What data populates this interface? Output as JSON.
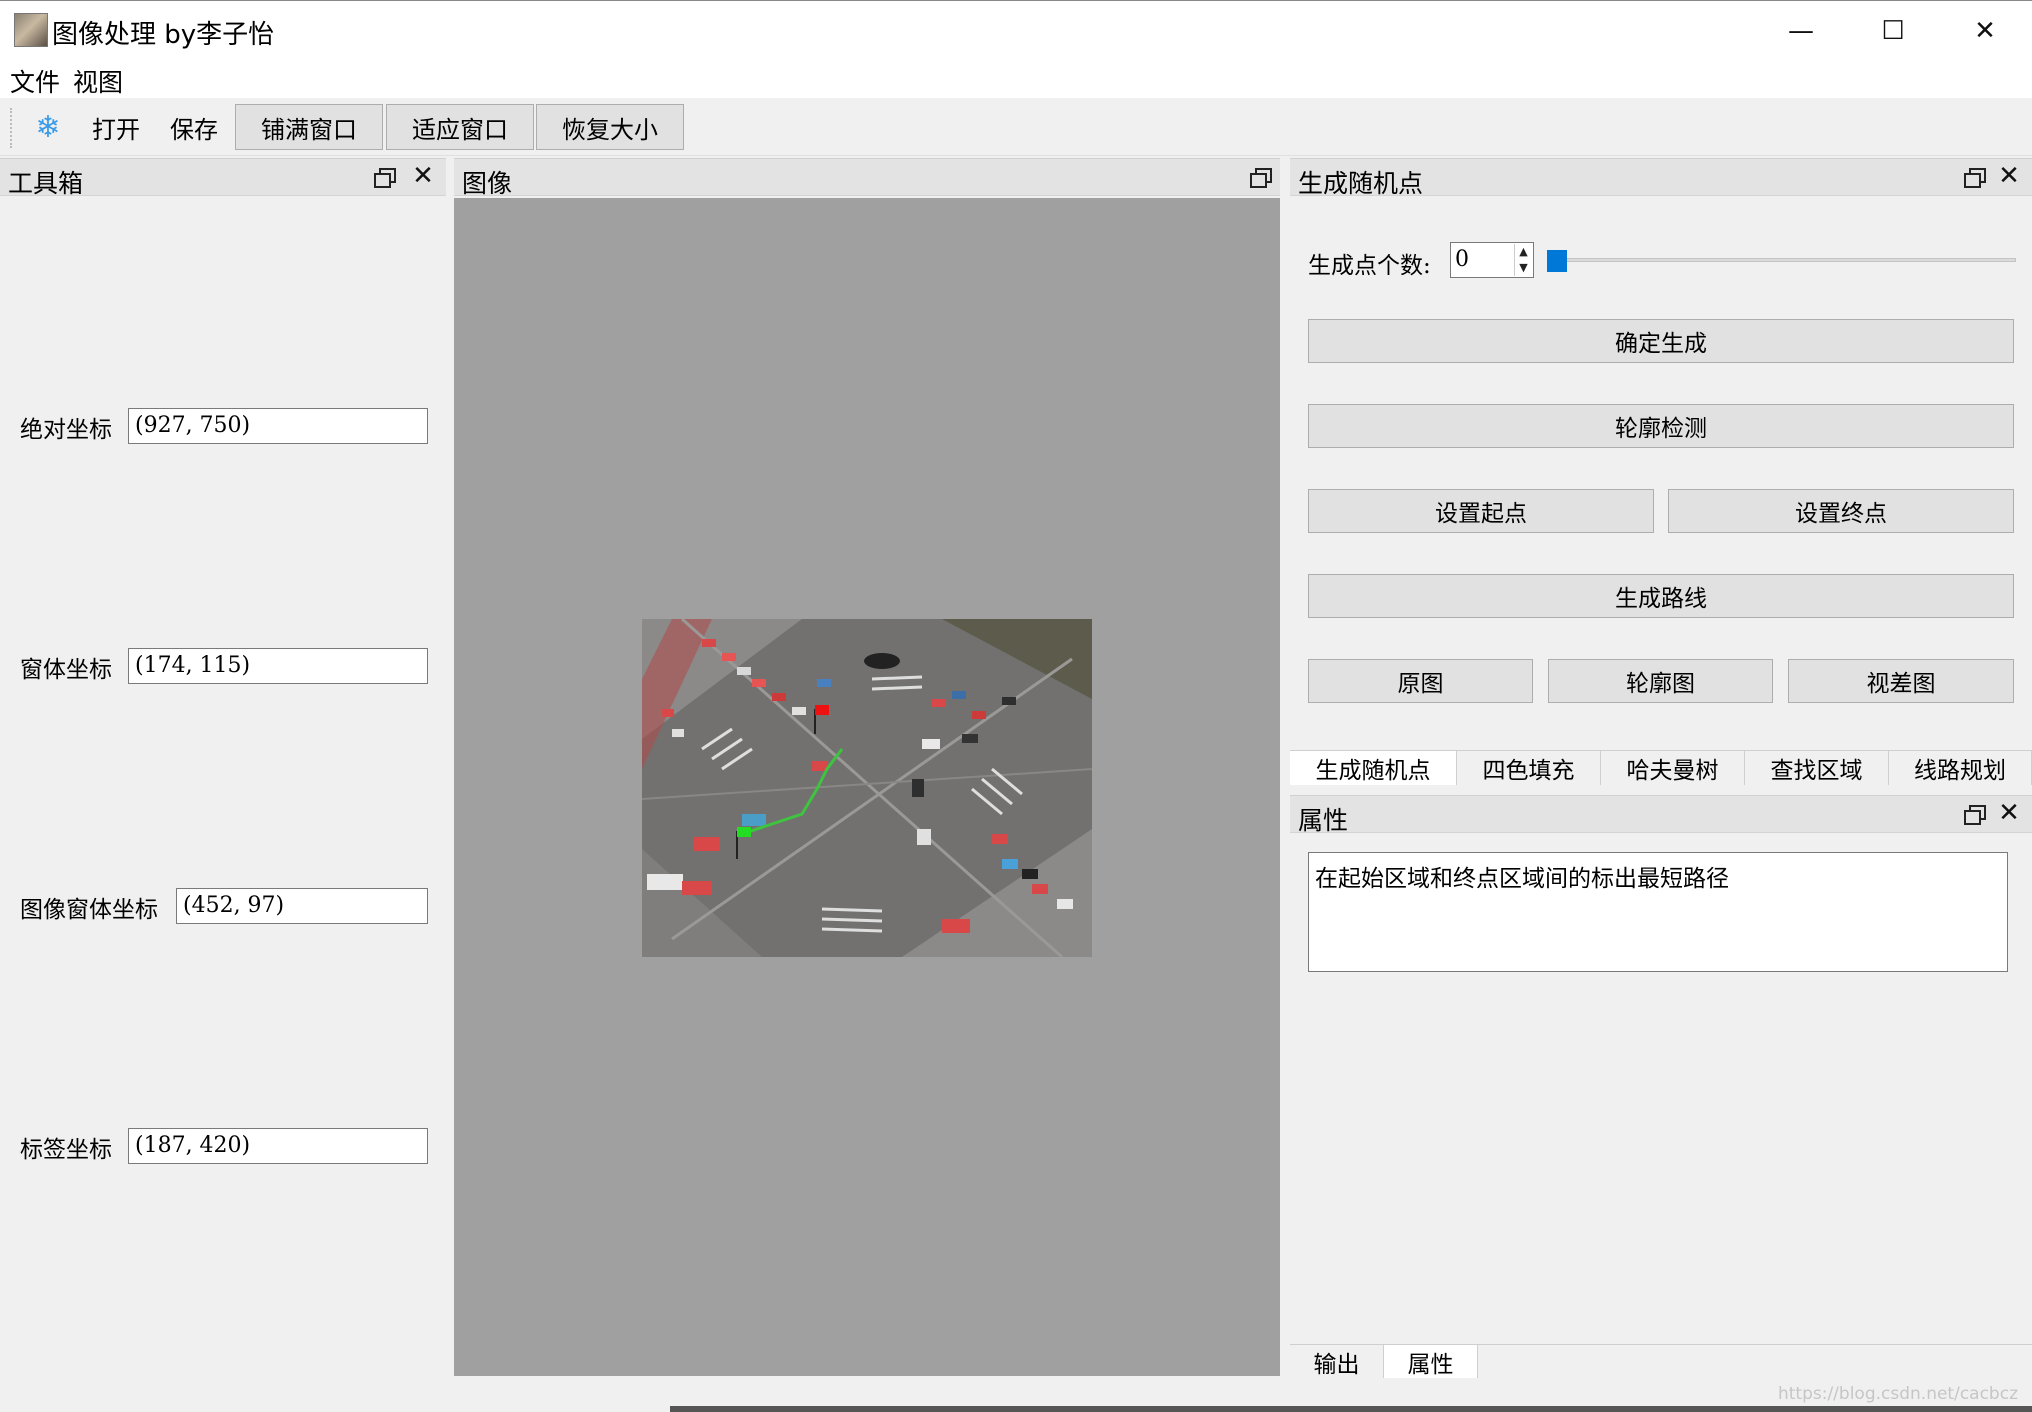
{
  "window": {
    "title": "图像处理 by李子怡",
    "minimize_glyph": "—",
    "maximize_glyph": "☐",
    "close_glyph": "✕"
  },
  "menu": {
    "items": [
      "文件",
      "视图"
    ]
  },
  "toolbar": {
    "icon": "snowflake-icon",
    "open": "打开",
    "save": "保存",
    "fill_window": "铺满窗口",
    "fit_window": "适应窗口",
    "restore_size": "恢复大小"
  },
  "toolbox": {
    "title": "工具箱",
    "absolute_label": "绝对坐标",
    "absolute_value": "(927, 750)",
    "window_label": "窗体坐标",
    "window_value": "(174, 115)",
    "image_window_label": "图像窗体坐标",
    "image_window_value": "(452, 97)",
    "label_label": "标签坐标",
    "label_value": "(187, 420)"
  },
  "image_panel": {
    "title": "图像"
  },
  "random_panel": {
    "title": "生成随机点",
    "count_label": "生成点个数:",
    "count_value": "0",
    "slider_value": 0,
    "btn_confirm": "确定生成",
    "btn_contour": "轮廓检测",
    "btn_start": "设置起点",
    "btn_end": "设置终点",
    "btn_route": "生成路线",
    "btn_original": "原图",
    "btn_contour_map": "轮廓图",
    "btn_disparity": "视差图",
    "tabs": [
      "生成随机点",
      "四色填充",
      "哈夫曼树",
      "查找区域",
      "线路规划"
    ],
    "active_tab": 0
  },
  "properties": {
    "title": "属性",
    "text": "在起始区域和终点区域间的标出最短路径"
  },
  "bottom_tabs": [
    "输出",
    "属性"
  ],
  "bottom_active": 1,
  "watermark": "https://blog.csdn.net/cacbcz",
  "colors": {
    "accent": "#0078d7",
    "canvas": "#a0a0a0",
    "start_flag": "#22dd22",
    "end_flag": "#ee1111",
    "route": "#3ec43e"
  }
}
